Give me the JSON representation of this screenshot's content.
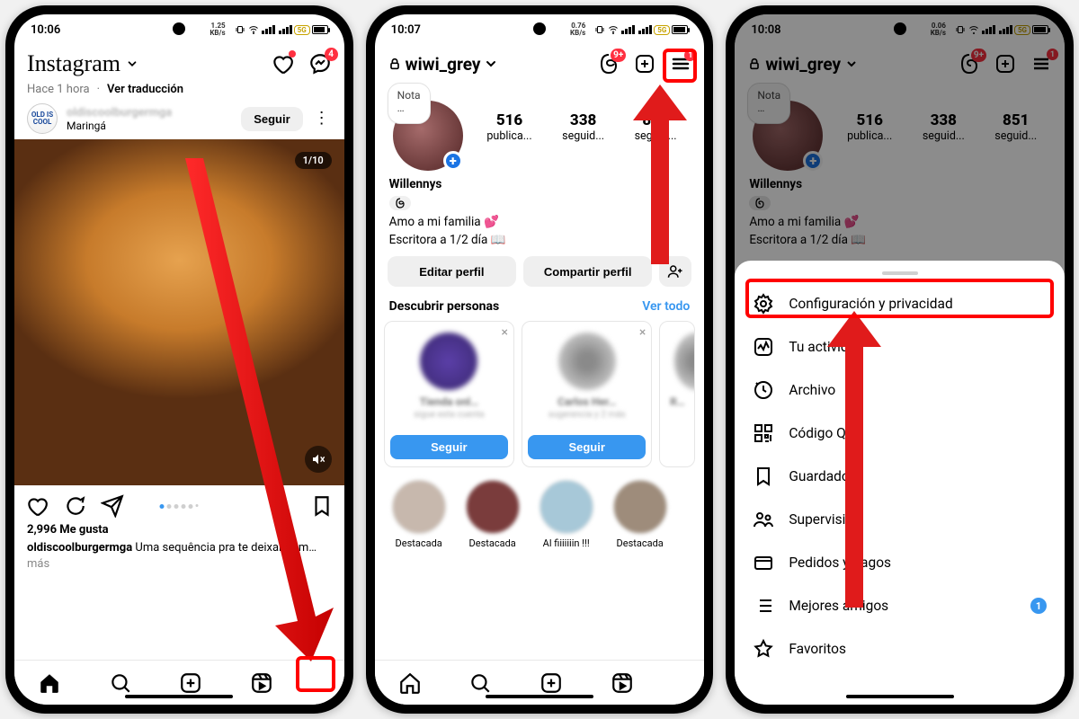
{
  "phone1": {
    "time": "10:06",
    "kbs": "1.25\nKB/s",
    "pill": "5G",
    "logo": "Instagram",
    "heart_badge_dot": true,
    "msg_badge": "4",
    "sub_time": "Hace 1 hora",
    "sub_sep": "·",
    "sub_link": "Ver traducción",
    "post_user_blurred": "oldiscoolburgermga",
    "post_loc": "Maringá",
    "follow_label": "Seguir",
    "img_counter": "1/10",
    "likes_text": "2,996 Me gusta",
    "caption_user": "oldiscoolburgermga",
    "caption_text": " Uma sequência pra te deixar com… ",
    "caption_more": "más",
    "avatar_text": "OLD IS COOL"
  },
  "phone2": {
    "time": "10:07",
    "kbs": "0.76\nKB/s",
    "pill": "5G",
    "username": "wiwi_grey",
    "threads_badge": "9+",
    "menu_badge": "1",
    "note_label": "Nota",
    "note_dots": "…",
    "stats": [
      {
        "num": "516",
        "label": "publica..."
      },
      {
        "num": "338",
        "label": "seguid..."
      },
      {
        "num": "851",
        "label": "seguid..."
      }
    ],
    "display_name": "Willennys",
    "threads_icon": "@",
    "bio1": "Amo a mi familia 💕",
    "bio2": "Escritora a 1/2 día 📖",
    "edit_label": "Editar perfil",
    "share_label": "Compartir perfil",
    "discover_heading": "Descubrir personas",
    "discover_link": "Ver todo",
    "card_follow": "Seguir",
    "highlights": [
      "Destacada",
      "Destacada",
      "Al fiiiiiiin !!!",
      "Destacada"
    ]
  },
  "phone3": {
    "time": "10:08",
    "kbs": "0.06\nKB/s",
    "pill": "5G",
    "username": "wiwi_grey",
    "threads_badge": "9+",
    "menu_badge": "1",
    "note_label": "Nota",
    "note_dots": "…",
    "stats": [
      {
        "num": "516",
        "label": "publica..."
      },
      {
        "num": "338",
        "label": "seguid..."
      },
      {
        "num": "851",
        "label": "seguid..."
      }
    ],
    "display_name": "Willennys",
    "bio1": "Amo a mi familia 💕",
    "bio2": "Escritora a 1/2 día 📖",
    "menu": [
      {
        "icon": "settings",
        "label": "Configuración y privacidad",
        "highlight": true
      },
      {
        "icon": "activity",
        "label": "Tu actividad"
      },
      {
        "icon": "archive",
        "label": "Archivo"
      },
      {
        "icon": "qr",
        "label": "Código QR"
      },
      {
        "icon": "bookmark",
        "label": "Guardado"
      },
      {
        "icon": "supervision",
        "label": "Supervisión"
      },
      {
        "icon": "card",
        "label": "Pedidos y pagos"
      },
      {
        "icon": "closefriends",
        "label": "Mejores amigos",
        "badge": "1"
      },
      {
        "icon": "star",
        "label": "Favoritos"
      }
    ]
  }
}
